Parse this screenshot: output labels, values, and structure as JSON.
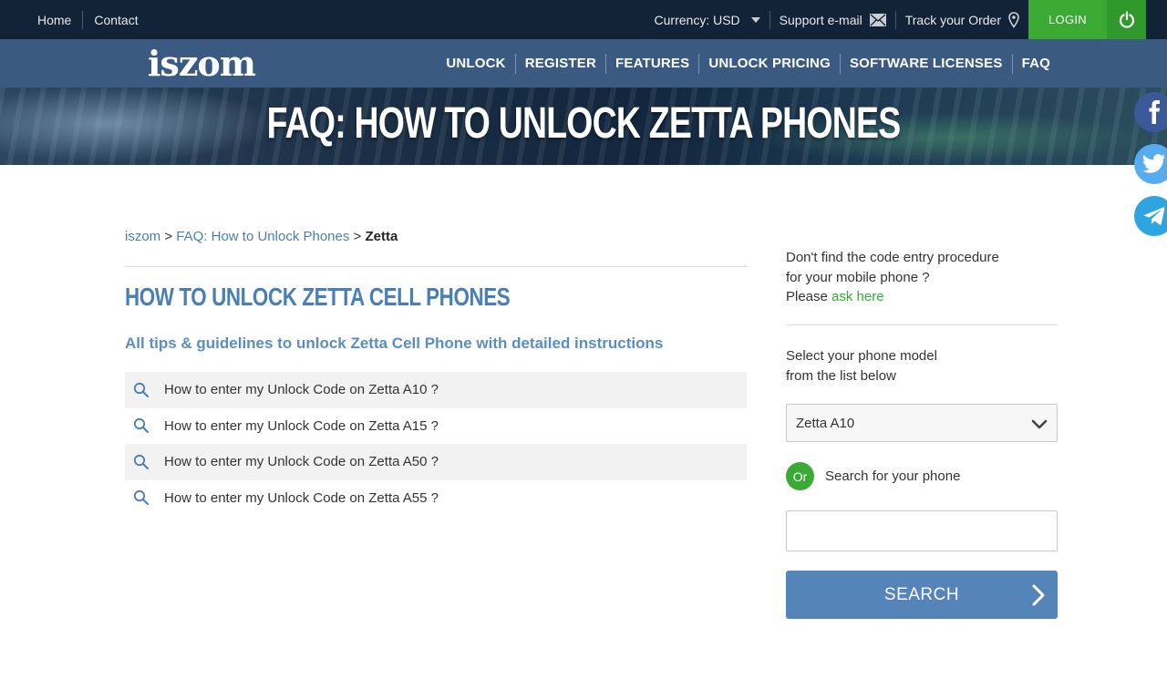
{
  "topbar": {
    "links": [
      "Home",
      "Contact"
    ],
    "currency_label": "Currency: USD",
    "support_label": "Support e-mail",
    "track_label": "Track your Order",
    "login_label": "LOGIN"
  },
  "nav": {
    "logo": "iszom",
    "menu": [
      "UNLOCK",
      "REGISTER",
      "FEATURES",
      "UNLOCK PRICING",
      "SOFTWARE LICENSES",
      "FAQ"
    ]
  },
  "banner": {
    "title": "FAQ: HOW TO UNLOCK ZETTA PHONES"
  },
  "social": [
    "facebook-icon",
    "twitter-icon",
    "telegram-icon"
  ],
  "breadcrumb": {
    "home": "iszom",
    "sep1": " > ",
    "faq": "FAQ: How to Unlock Phones",
    "sep2": " > ",
    "current": "Zetta"
  },
  "main": {
    "heading": "HOW TO UNLOCK ZETTA CELL PHONES",
    "subtitle": "All tips & guidelines to unlock Zetta Cell Phone with detailed instructions",
    "faq_items": [
      "How to enter my Unlock Code on Zetta A10 ?",
      "How to enter my Unlock Code on Zetta A15 ?",
      "How to enter my Unlock Code on Zetta A50 ?",
      "How to enter my Unlock Code on Zetta A55 ?"
    ]
  },
  "sidebar": {
    "help_line1": "Don't find the code entry procedure",
    "help_line2": "for your mobile phone ?",
    "help_please": "Please ",
    "help_link": "ask here",
    "select_line1": "Select your phone model",
    "select_line2": "from the list below",
    "selected_model": "Zetta A10",
    "or_badge": "Or",
    "or_text": "Search for your phone",
    "search_value": "",
    "search_button": "SEARCH"
  },
  "colors": {
    "topbar_bg": "#132337",
    "navbar_bg": "#3a5a82",
    "accent_green": "#3aaa35",
    "link_blue": "#4a7fb5",
    "button_blue": "#5584b8"
  }
}
